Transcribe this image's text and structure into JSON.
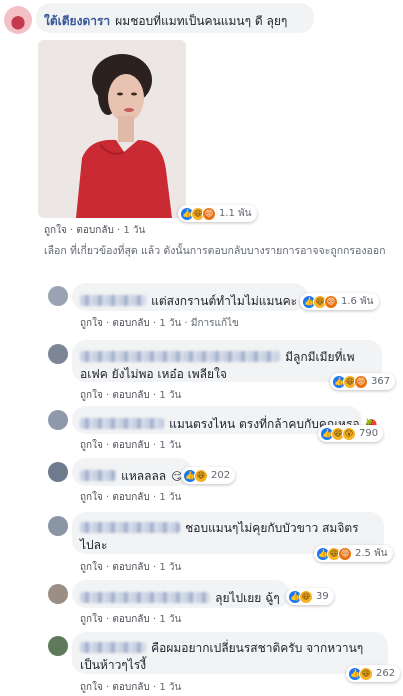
{
  "post": {
    "author": "ใต้เตียงดารา",
    "text": "ผมชอบที่แมทเป็นคนแมนๆ ดี ลุยๆ",
    "reactions": [
      "like-icon",
      "haha-icon",
      "angry-icon"
    ],
    "reaction_count": "1.1 พัน",
    "actions": {
      "like": "ถูกใจ",
      "reply": "ตอบกลับ",
      "sep": "·",
      "time": "1 วัน"
    }
  },
  "notice": "เลือก ที่เกี่ยวข้องที่สุด แล้ว ดังนั้นการตอบกลับบางรายการอาจจะถูกกรองออก",
  "replies": [
    {
      "text": "แต่สงกรานต์ทำไมไม่แมนคะ",
      "reactions": [
        "like-icon",
        "haha-icon",
        "angry-icon"
      ],
      "count": "1.6 พัน",
      "actions": {
        "like": "ถูกใจ",
        "reply": "ตอบกลับ",
        "time": "1 วัน",
        "extra": "มีการแก้ไข"
      }
    },
    {
      "text": "มีลูกมีเมียที่เพอเฟค ยังไม่พอ เหอ๋อ เพลียใจ",
      "reactions": [
        "like-icon",
        "haha-icon",
        "angry-icon"
      ],
      "count": "367",
      "actions": {
        "like": "ถูกใจ",
        "reply": "ตอบกลับ",
        "time": "1 วัน"
      }
    },
    {
      "text": "แมนตรงไหน ตรงที่กล้าคบกับคุณหรอ",
      "emoji": "🍓",
      "reactions": [
        "like-icon",
        "haha-icon",
        "wow-icon"
      ],
      "count": "790",
      "actions": {
        "like": "ถูกใจ",
        "reply": "ตอบกลับ",
        "time": "1 วัน"
      }
    },
    {
      "text": "แหลลลล",
      "emoji": "😏",
      "reactions": [
        "like-icon",
        "haha-icon"
      ],
      "count": "202",
      "actions": {
        "like": "ถูกใจ",
        "reply": "ตอบกลับ",
        "time": "1 วัน"
      }
    },
    {
      "text": "ชอบแมนๆไม่คุยกับบัวขาว สมจิตร ไปละ",
      "reactions": [
        "like-icon",
        "haha-icon",
        "angry-icon"
      ],
      "count": "2.5 พัน",
      "actions": {
        "like": "ถูกใจ",
        "reply": "ตอบกลับ",
        "time": "1 วัน"
      }
    },
    {
      "text": "ลุยไปเยย ฉู้ๆ",
      "reactions": [
        "like-icon",
        "haha-icon"
      ],
      "count": "39",
      "actions": {
        "like": "ถูกใจ",
        "reply": "ตอบกลับ",
        "time": "1 วัน"
      }
    },
    {
      "text": "คือผมอยากเปลี่ยนรสชาติครับ จากหวานๆ เป็นห้าวๆไรงี้",
      "reactions": [
        "like-icon",
        "haha-icon"
      ],
      "count": "262",
      "actions": {
        "like": "ถูกใจ",
        "reply": "ตอบกลับ",
        "time": "1 วัน"
      }
    }
  ],
  "colors": {
    "link": "#385898",
    "bubble": "#f2f3f5",
    "like": "#1877f2",
    "dress": "#c92a33"
  }
}
